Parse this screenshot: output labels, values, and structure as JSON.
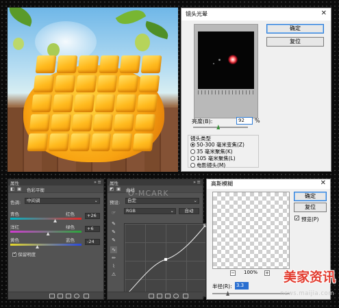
{
  "lens_flare": {
    "title": "镜头光晕",
    "ok": "确定",
    "reset": "复位",
    "brightness_label": "亮度(B):",
    "brightness_value": "92",
    "brightness_unit": "%",
    "brightness_level": 0.46,
    "lens_type_label": "镜头类型",
    "options": [
      {
        "label": "50-300 毫米变焦(Z)",
        "selected": true
      },
      {
        "label": "35 毫米聚焦(K)",
        "selected": false
      },
      {
        "label": "105 毫米聚焦(L)",
        "selected": false
      },
      {
        "label": "电影镜头(M)",
        "selected": false
      }
    ]
  },
  "color_balance": {
    "header": "属性",
    "title": "色彩平衡",
    "tone_label": "色调:",
    "tone_value": "中间调",
    "sliders": [
      {
        "left": "青色",
        "right": "红色",
        "value": "+26",
        "level": 0.63,
        "gradient": [
          "#00b7c7",
          "#e22a2a"
        ]
      },
      {
        "left": "洋红",
        "right": "绿色",
        "value": "+6",
        "level": 0.53,
        "gradient": [
          "#d23ad2",
          "#2aa83a"
        ]
      },
      {
        "left": "黄色",
        "right": "蓝色",
        "value": "-24",
        "level": 0.38,
        "gradient": [
          "#e6d82a",
          "#2a4ae0"
        ]
      }
    ],
    "preserve_luminosity": "保留明度"
  },
  "curves": {
    "header": "属性",
    "title": "曲线",
    "preset_label": "预设:",
    "preset_value": "自定",
    "channel_value": "RGB",
    "auto_label": "自动",
    "watermark": "O-MCARK"
  },
  "gaussian_blur": {
    "title": "高斯模糊",
    "ok": "确定",
    "reset": "复位",
    "preview_label": "预览(P)",
    "preview_checked": true,
    "zoom_out": "−",
    "zoom_in": "+",
    "zoom": "100%",
    "radius_label": "半径(R):",
    "radius_value": "3.3",
    "radius_level": 0.2
  },
  "watermark": {
    "logo": "美家资讯",
    "url": "news.maijia.com"
  },
  "colors": {
    "accent": "#2c7bd6",
    "panel_dark": "#535353",
    "dialog_bg": "#f0f0f0",
    "logo_red": "#e23b2e"
  }
}
